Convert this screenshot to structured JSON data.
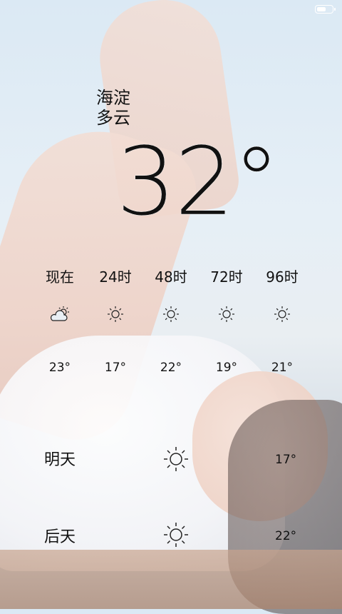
{
  "current": {
    "city": "海淀",
    "condition": "多云",
    "temperature": "32°"
  },
  "battery_level": 0.65,
  "forecast_hours": [
    {
      "label": "现在",
      "icon": "partly-cloudy-icon",
      "temp": "23°"
    },
    {
      "label": "24时",
      "icon": "sun-icon",
      "temp": "17°"
    },
    {
      "label": "48时",
      "icon": "sun-icon",
      "temp": "22°"
    },
    {
      "label": "72时",
      "icon": "sun-icon",
      "temp": "19°"
    },
    {
      "label": "96时",
      "icon": "sun-icon",
      "temp": "21°"
    }
  ],
  "forecast_days": [
    {
      "label": "明天",
      "icon": "sun-icon",
      "temp": "17°"
    },
    {
      "label": "后天",
      "icon": "sun-icon",
      "temp": "22°"
    }
  ]
}
